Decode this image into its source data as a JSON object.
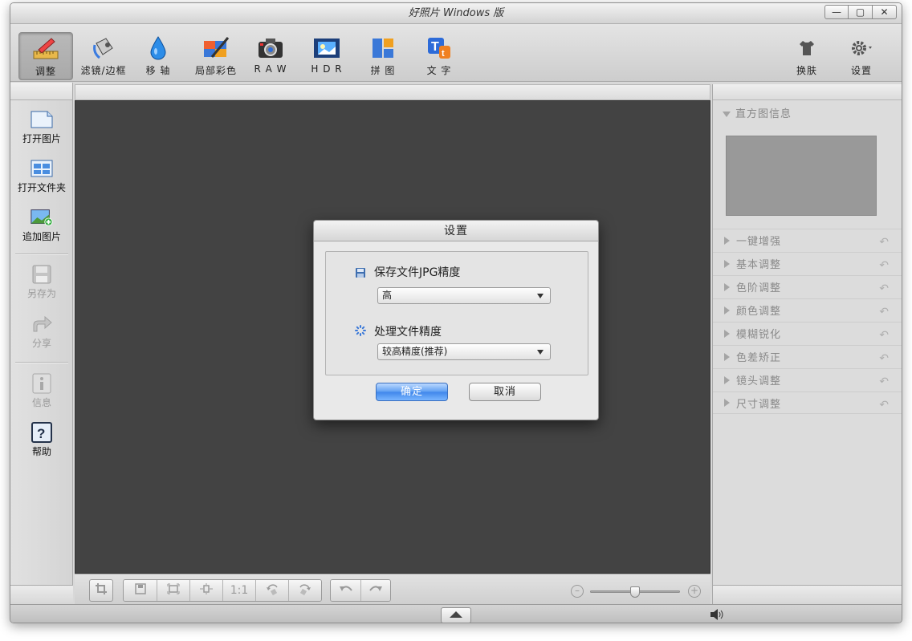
{
  "window": {
    "title": "好照片 Windows 版",
    "controls": {
      "minimize": "—",
      "maximize": "▢",
      "close": "✕"
    }
  },
  "toolbar": {
    "tools": [
      {
        "label": "调整",
        "icon": "ruler-pencil-icon",
        "active": true
      },
      {
        "label": "滤镜/边框",
        "icon": "paint-can-icon",
        "active": false
      },
      {
        "label": "移 轴",
        "icon": "water-drop-icon",
        "active": false
      },
      {
        "label": "局部彩色",
        "icon": "color-brush-icon",
        "active": false
      },
      {
        "label": "R A W",
        "icon": "camera-icon",
        "active": false
      },
      {
        "label": "H D R",
        "icon": "film-hdr-icon",
        "active": false
      },
      {
        "label": "拼 图",
        "icon": "collage-icon",
        "active": false
      },
      {
        "label": "文 字",
        "icon": "text-icon",
        "active": false
      }
    ],
    "skin_label": "换肤",
    "settings_label": "设置"
  },
  "left_panel": {
    "items": [
      {
        "label": "打开图片",
        "icon": "open-file-icon",
        "enabled": true
      },
      {
        "label": "打开文件夹",
        "icon": "open-folder-icon",
        "enabled": true
      },
      {
        "label": "追加图片",
        "icon": "add-image-icon",
        "enabled": true
      },
      {
        "label": "另存为",
        "icon": "save-as-icon",
        "enabled": false
      },
      {
        "label": "分享",
        "icon": "share-icon",
        "enabled": false
      },
      {
        "label": "信息",
        "icon": "info-icon",
        "enabled": false
      },
      {
        "label": "帮助",
        "icon": "help-icon",
        "enabled": true
      }
    ]
  },
  "bottom_bar": {
    "actual_size_label": "1:1",
    "zoom_level": 0.5
  },
  "right_panel": {
    "histogram_title": "直方图信息",
    "sections": [
      "一键增强",
      "基本调整",
      "色阶调整",
      "颜色调整",
      "模糊锐化",
      "色差矫正",
      "镜头调整",
      "尺寸调整"
    ]
  },
  "dialog": {
    "title": "设置",
    "jpg_quality_label": "保存文件JPG精度",
    "jpg_quality_value": "高",
    "processing_label": "处理文件精度",
    "processing_value": "较高精度(推荐)",
    "ok_label": "确定",
    "cancel_label": "取消"
  },
  "colors": {
    "canvas": "#434343",
    "accent_blue": "#4a8ff0",
    "window_bg": "#d8d8d8"
  }
}
